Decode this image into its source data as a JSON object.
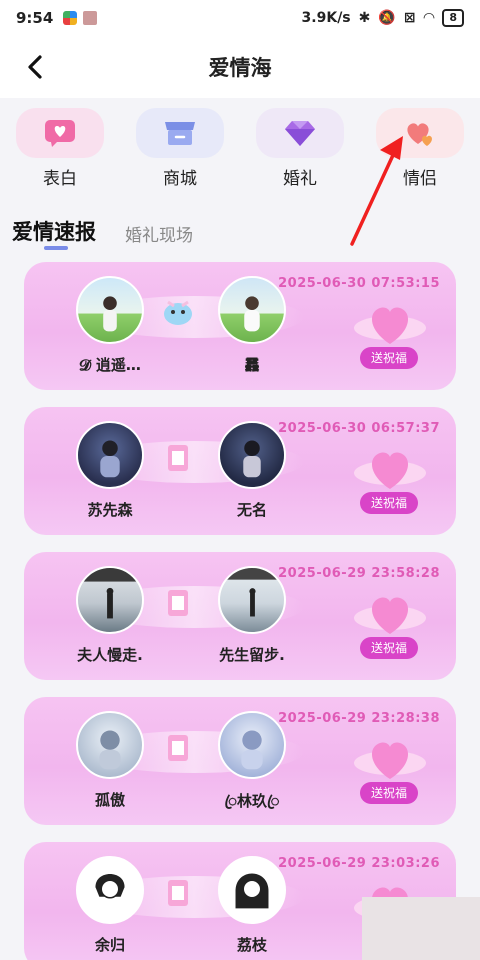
{
  "status": {
    "time": "9:54",
    "speed": "3.9K/s",
    "battery": "8"
  },
  "nav": {
    "title": "爱情海",
    "back": "‹"
  },
  "categories": [
    {
      "label": "表白",
      "icon": "heart-message-icon",
      "bg": "#f9e0ee"
    },
    {
      "label": "商城",
      "icon": "shop-icon",
      "bg": "#e7e9f9"
    },
    {
      "label": "婚礼",
      "icon": "diamond-icon",
      "bg": "#efe8f7"
    },
    {
      "label": "情侣",
      "icon": "couple-heart-icon",
      "bg": "#fbe7ea"
    }
  ],
  "tabs": {
    "active": "爱情速报",
    "inactive": "婚礼现场"
  },
  "bless_label": "送祝福",
  "cards": [
    {
      "left_name": "𝓓 逍遥…",
      "right_name": "䨺",
      "date": "2025-06-30 07:53:15"
    },
    {
      "left_name": "苏先森",
      "right_name": "无名",
      "date": "2025-06-30 06:57:37"
    },
    {
      "left_name": "夫人慢走.",
      "right_name": "先生留步.",
      "date": "2025-06-29 23:58:28"
    },
    {
      "left_name": "孤傲",
      "right_name": "ꦿ林玖ꦿ",
      "date": "2025-06-29 23:28:38"
    },
    {
      "left_name": "余归",
      "right_name": "荔枝",
      "date": "2025-06-29 23:03:26"
    }
  ]
}
